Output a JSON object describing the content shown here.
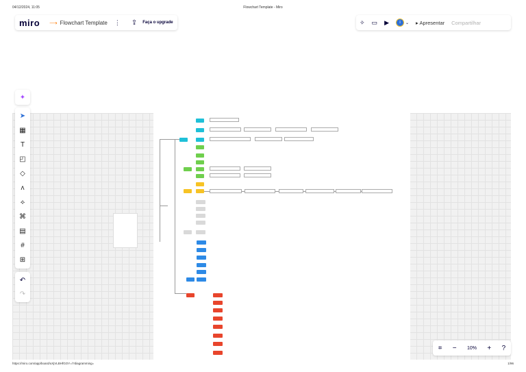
{
  "print": {
    "datetime": "04/12/2024, 11:05",
    "title": "Flowchart Template - Miro",
    "url": "https://miro.com/app/board/uXjVLBHfGOY=/?diagramming=",
    "page": "1/96"
  },
  "topbar": {
    "logo": "miro",
    "board_name": "Flowchart Template",
    "upgrade_label": "Faça o upgrade"
  },
  "rightbar": {
    "avatar_initial": "i",
    "present_label": "Apresentar",
    "share_label": "Compartilhar"
  },
  "zoom": {
    "level_label": "10%"
  },
  "colors": {
    "cyan": "#1fc0d8",
    "green": "#6fcf4d",
    "yellow": "#f7c325",
    "gray": "#d9d9d9",
    "blue": "#2d8ae6",
    "red": "#e8452c"
  }
}
